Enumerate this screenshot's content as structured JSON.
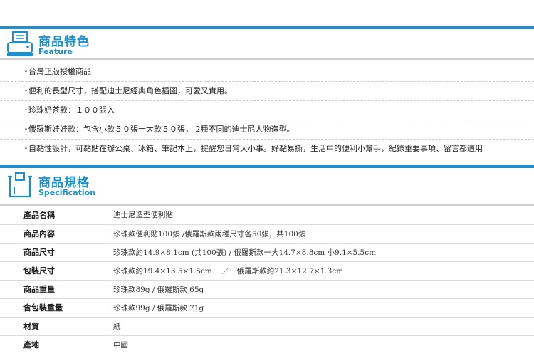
{
  "feature_header": {
    "title": "商品特色",
    "subtitle": "Feature",
    "icon": "printer-icon"
  },
  "features": [
    "台灣正版授權商品",
    "便利的長型尺寸，搭配迪士尼經典角色插圖，可愛又實用。",
    "珍珠奶茶款：１００張入",
    "俄羅斯娃娃款：包含小款５０張十大款５０張， 2種不同的迪士尼人物造型。",
    "自黏性設計，可黏貼在辦公桌、冰箱、筆記本上，提醒您日常大小事。好黏易撕，生活中的便利小幫手，紀錄重要事項、留言都適用"
  ],
  "feature_bullet": "・",
  "spec_header": {
    "title": "商品規格",
    "subtitle": "Specification",
    "icon": "box-icon"
  },
  "specs": [
    {
      "label": "產品名稱",
      "value": "迪士尼造型便利貼"
    },
    {
      "label": "商品內容",
      "value": "珍珠款便利貼100張 /俄羅斯款兩種尺寸各50張，共100張"
    },
    {
      "label": "商品尺寸",
      "value": "珍珠款約14.9×8.1cm (共100張) / 俄羅斯款一大14.7×8.8cm 小9.1×5.5cm"
    },
    {
      "label": "包裝尺寸",
      "value": "珍珠款約19.4×13.5×1.5cm　 ／　俄羅斯款約21.3×12.7×1.3cm"
    },
    {
      "label": "商品重量",
      "value": "珍珠款89g / 俄羅斯款 65g"
    },
    {
      "label": "含包裝重量",
      "value": "珍珠款99g / 俄羅斯款 71g"
    },
    {
      "label": "材質",
      "value": "紙"
    },
    {
      "label": "產地",
      "value": "中國"
    }
  ],
  "colors": {
    "accent": "#1a90d0"
  }
}
